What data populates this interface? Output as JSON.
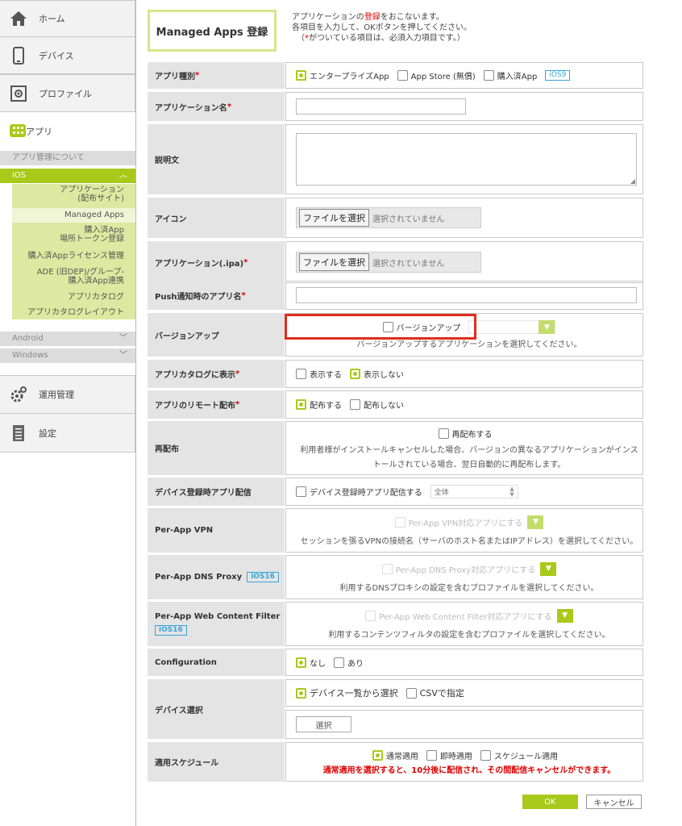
{
  "sidebar": {
    "home": "ホーム",
    "device": "デバイス",
    "profile": "プロファイル",
    "app": "アプリ",
    "about": "アプリ管理について",
    "ios": "iOS",
    "ios_items": {
      "app_dist_1": "アプリケーション",
      "app_dist_2": "(配布サイト)",
      "managed": "Managed Apps",
      "vpp_1": "購入済App",
      "vpp_2": "場所トークン登録",
      "vpp_license": "購入済Appライセンス管理",
      "ade_1": "ADE (旧DEP)/グループ-",
      "ade_2": "購入済App連携",
      "catalog": "アプリカタログ",
      "catalog_layout": "アプリカタログレイアウト"
    },
    "android": "Android",
    "windows": "Windows",
    "ops": "運用管理",
    "settings": "設定"
  },
  "header": {
    "title": "Managed Apps 登録",
    "intro1_pre": "アプリケーションの",
    "intro1_red": "登録",
    "intro1_post": "をおこないます。",
    "intro2": "各項目を入力して、OKボタンを押してください。",
    "intro3_pre": "（",
    "intro3_red": "*",
    "intro3_post": "がついている項目は、必須入力項目です。）"
  },
  "form": {
    "app_type": {
      "label": "アプリ種別",
      "opt1": "エンタープライズApp",
      "opt2": "App Store (無償)",
      "opt3": "購入済App",
      "badge": "iOS9"
    },
    "app_name": {
      "label": "アプリケーション名"
    },
    "description": {
      "label": "説明文"
    },
    "icon": {
      "label": "アイコン",
      "button": "ファイルを選択",
      "status": "選択されていません"
    },
    "ipa": {
      "label": "アプリケーション(.ipa)",
      "button": "ファイルを選択",
      "status": "選択されていません"
    },
    "push_name": {
      "label": "Push通知時のアプリ名"
    },
    "version_up": {
      "label": "バージョンアップ",
      "checkbox": "バージョンアップ",
      "note": "バージョンアップするアプリケーションを選択してください。"
    },
    "catalog_show": {
      "label": "アプリカタログに表示",
      "opt1": "表示する",
      "opt2": "表示しない"
    },
    "remote_dist": {
      "label": "アプリのリモート配布",
      "opt1": "配布する",
      "opt2": "配布しない"
    },
    "redist": {
      "label": "再配布",
      "checkbox": "再配布する",
      "note1": "利用者様がインストールキャンセルした場合、バージョンの異なるアプリケーションがインス",
      "note2": "トールされている場合、翌日自動的に再配布します。"
    },
    "enroll_dist": {
      "label": "デバイス登録時アプリ配信",
      "checkbox": "デバイス登録時アプリ配信する",
      "select": "全体"
    },
    "per_app_vpn": {
      "label": "Per-App VPN",
      "checkbox": "Per-App VPN対応アプリにする",
      "note": "セッションを張るVPNの接続名（サーバのホスト名またはIPアドレス）を選択してください。"
    },
    "dns_proxy": {
      "label": "Per-App DNS Proxy",
      "badge": "iOS16",
      "checkbox": "Per-App DNS Proxy対応アプリにする",
      "note": "利用するDNSプロキシの設定を含むプロファイルを選択してください。"
    },
    "content_filter": {
      "label": "Per-App Web Content Filter",
      "badge": "iOS16",
      "checkbox": "Per-App Web Content Filter対応アプリにする",
      "note": "利用するコンテンツフィルタの設定を含むプロファイルを選択してください。"
    },
    "configuration": {
      "label": "Configuration",
      "opt1": "なし",
      "opt2": "あり"
    },
    "device_select": {
      "label": "デバイス選択",
      "opt1": "デバイス一覧から選択",
      "opt2": "CSVで指定",
      "button": "選択"
    },
    "schedule": {
      "label": "適用スケジュール",
      "opt1": "通常適用",
      "opt2": "即時適用",
      "opt3": "スケジュール適用",
      "warning": "通常適用を選択すると、10分後に配信され、その間配信キャンセルができます。"
    }
  },
  "actions": {
    "ok": "OK",
    "cancel": "キャンセル"
  },
  "colors": {
    "accent": "#a9c91b",
    "required": "#dd0000",
    "highlight": "#e02d1b",
    "badge": "#38a5d8"
  }
}
